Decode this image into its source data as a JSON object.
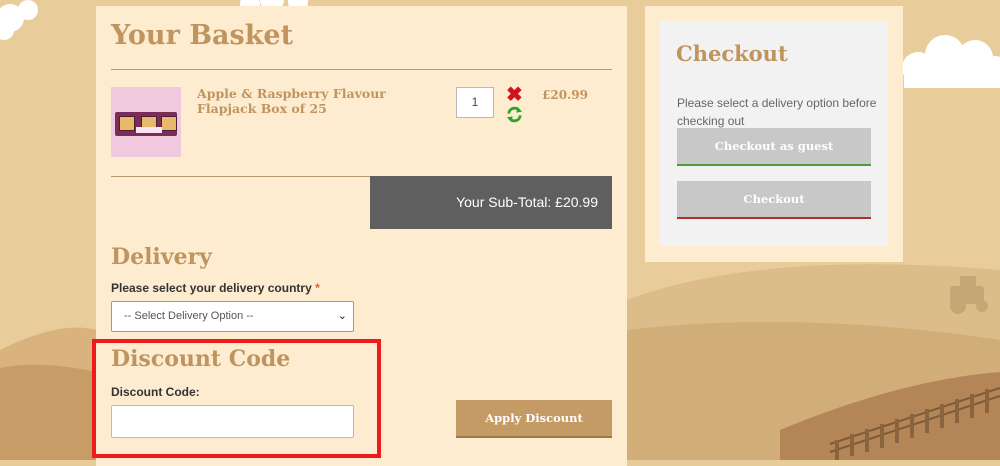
{
  "basket": {
    "title": "Your Basket",
    "item": {
      "name": "Apple & Raspberry Flavour Flapjack Box of 25",
      "quantity": "1",
      "price": "£20.99",
      "remove_icon": "close-icon",
      "update_icon": "refresh-icon"
    },
    "subtotal": "Your Sub-Total: £20.99"
  },
  "delivery": {
    "title": "Delivery",
    "country_label": "Please select your delivery country",
    "required_mark": "*",
    "select_value": "-- Select Delivery Option --"
  },
  "discount": {
    "title": "Discount Code",
    "field_label": "Discount Code:",
    "input_value": "",
    "apply_label": "Apply Discount"
  },
  "checkout": {
    "title": "Checkout",
    "message": "Please select a delivery option before checking out",
    "guest_label": "Checkout as guest",
    "checkout_label": "Checkout"
  },
  "colors": {
    "accent": "#c0945e",
    "highlight": "#ee1b1b",
    "subtotal_bg": "#5f5f5f"
  }
}
